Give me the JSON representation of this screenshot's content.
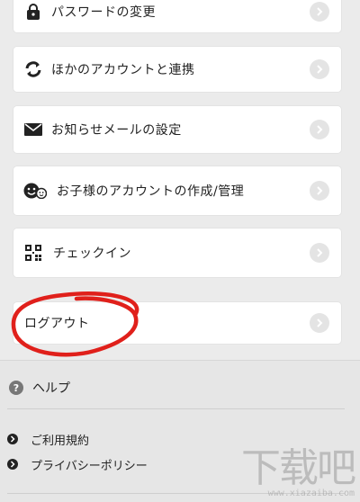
{
  "menu": {
    "items": [
      {
        "label": "パスワードの変更",
        "icon": "lock-icon"
      },
      {
        "label": "ほかのアカウントと連携",
        "icon": "sync-link-icon"
      },
      {
        "label": "お知らせメールの設定",
        "icon": "mail-icon"
      },
      {
        "label": "お子様のアカウントの作成/管理",
        "icon": "kids-face-icon"
      },
      {
        "label": "チェックイン",
        "icon": "qr-code-icon"
      },
      {
        "label": "ログアウト",
        "icon": ""
      }
    ]
  },
  "footer": {
    "help_label": "ヘルプ",
    "help_icon_text": "?",
    "links": [
      {
        "label": "ご利用規約"
      },
      {
        "label": "プライバシーポリシー"
      }
    ]
  },
  "annotation": {
    "color": "#e0201b"
  },
  "watermark": {
    "text": "下载吧",
    "url": "www.xiazaiba.com"
  }
}
